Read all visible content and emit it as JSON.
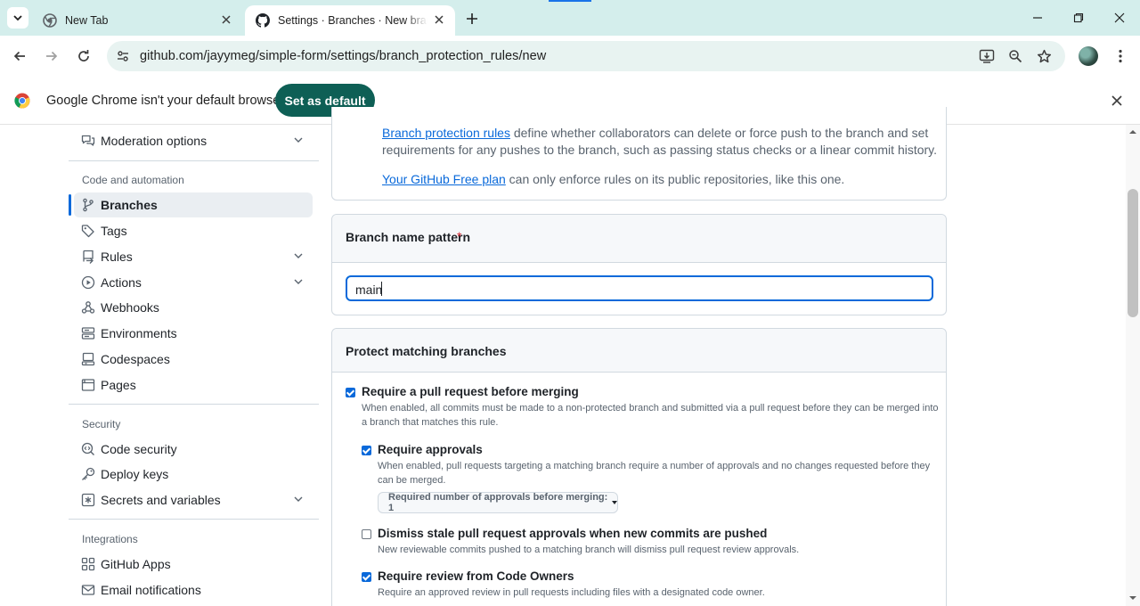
{
  "browser": {
    "tabs": [
      {
        "title": "New Tab",
        "favicon": "chrome-icon"
      },
      {
        "title": "Settings · Branches · New branch protection rule",
        "favicon": "github-icon",
        "active": true
      }
    ],
    "url": "github.com/jayymeg/simple-form/settings/branch_protection_rules/new",
    "infobar": {
      "message": "Google Chrome isn't your default browser",
      "button": "Set as default"
    },
    "accent_color": "#0e5f55"
  },
  "sidebar": {
    "top_items": [
      {
        "label": "Moderation options",
        "icon": "comment-discussion-icon",
        "expandable": true
      }
    ],
    "sections": [
      {
        "heading": "Code and automation",
        "items": [
          {
            "label": "Branches",
            "icon": "git-branch-icon",
            "active": true
          },
          {
            "label": "Tags",
            "icon": "tag-icon"
          },
          {
            "label": "Rules",
            "icon": "repo-push-icon",
            "expandable": true
          },
          {
            "label": "Actions",
            "icon": "play-icon",
            "expandable": true
          },
          {
            "label": "Webhooks",
            "icon": "webhook-icon"
          },
          {
            "label": "Environments",
            "icon": "server-icon"
          },
          {
            "label": "Codespaces",
            "icon": "codespaces-icon"
          },
          {
            "label": "Pages",
            "icon": "browser-icon"
          }
        ]
      },
      {
        "heading": "Security",
        "items": [
          {
            "label": "Code security",
            "icon": "codescan-icon"
          },
          {
            "label": "Deploy keys",
            "icon": "key-icon"
          },
          {
            "label": "Secrets and variables",
            "icon": "key-asterisk-icon",
            "expandable": true
          }
        ]
      },
      {
        "heading": "Integrations",
        "items": [
          {
            "label": "GitHub Apps",
            "icon": "apps-icon"
          },
          {
            "label": "Email notifications",
            "icon": "mail-icon"
          }
        ]
      }
    ]
  },
  "intro": {
    "line1_link": "Branch protection rules",
    "line1_rest": " define whether collaborators can delete or force push to the branch and set",
    "line2": "requirements for any pushes to the branch, such as passing status checks or a linear commit history.",
    "line3_link": "Your GitHub Free plan",
    "line3_rest": " can only enforce rules on its public repositories, like this one."
  },
  "pattern": {
    "label": "Branch name pattern",
    "required_marker": "*",
    "value": "main"
  },
  "protect": {
    "heading": "Protect matching branches",
    "options": [
      {
        "title": "Require a pull request before merging",
        "checked": true,
        "desc_line1": "When enabled, all commits must be made to a non-protected branch and submitted via a pull request before they can be merged into",
        "desc_line2": "a branch that matches this rule."
      },
      {
        "title": "Require approvals",
        "checked": true,
        "desc_line1": "When enabled, pull requests targeting a matching branch require a number of approvals and no changes requested before they",
        "desc_line2": "can be merged.",
        "dropdown": "Required number of approvals before merging: 1"
      },
      {
        "title": "Dismiss stale pull request approvals when new commits are pushed",
        "checked": false,
        "desc_line1": "New reviewable commits pushed to a matching branch will dismiss pull request review approvals."
      },
      {
        "title": "Require review from Code Owners",
        "checked": true,
        "desc_line1": "Require an approved review in pull requests including files with a designated code owner."
      }
    ]
  }
}
